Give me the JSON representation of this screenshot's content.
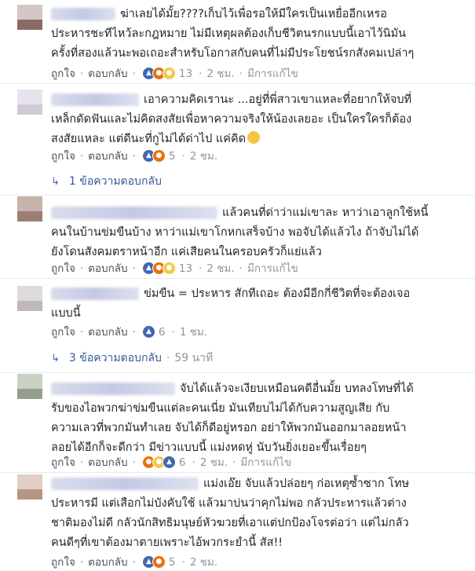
{
  "actions": {
    "like_label": "ถูกใจ",
    "reply_label": "ตอบกลับ",
    "edited_label": "มีการแก้ไข"
  },
  "comments": [
    {
      "text": "ฆ่าเลยได้มั้ย????เก็บไว้เพื่อรอให้มีใครเป็นเหยื่ออีกเหรอ\nประหารชะทีไหว้ละกฎหมาย ไม่มีเหตุผลต้องเก็บชีวิตนรกแบบนี้เอาไว้นิมัน\nครั้งที่สองแล้วนะพอเถอะสำหรับโอกาสกับคนที่ไม่มีประโยชน์รกสังคมเปล่าๆ",
      "reaction_count": "13",
      "time": "2 ชม.",
      "edited": true,
      "reactions": [
        "like",
        "angry",
        "sad"
      ]
    },
    {
      "text": "เอาความคิดเรานะ ...อยู่ที่พี่สาวเขาแหละที่อยากให้จบที่\nเหล็กดัดฟันและไม่คิดสงสัยเพื่อหาความจริงให้น้องเลยอะ เป็นใครใครก็ต้อง\nสงสัยแหละ แต่ดีนะที่กูไม่ได้ด่าไป แค่คิด",
      "emoji": "grin-emoji",
      "reaction_count": "5",
      "time": "2 ชม.",
      "edited": false,
      "reactions": [
        "like",
        "angry"
      ],
      "replies": "1 ข้อความตอบกลับ"
    },
    {
      "text": "แล้วคนที่ด่าว่าแม่เขาละ หาว่าเอาลูกใช้หนี้\nคนในบ้านข่มขืนบ้าง หาว่าแม่เขาโกหกเสร็จบ้าง พอจับได้แล้วไง ถ้าจับไม่ได้\nยังโดนสังคมตราหน้าอีก แค่เสียคนในครอบครัวก็แย่แล้ว",
      "reaction_count": "13",
      "time": "2 ชม.",
      "edited": true,
      "reactions": [
        "like",
        "angry",
        "sad"
      ]
    },
    {
      "text": "ข่มขืน = ประหาร สักทีเถอะ ต้องมีอีกกี่ชีวิตที่จะต้องเจอ\nแบบนี้",
      "reaction_count": "6",
      "time": "1 ชม.",
      "edited": false,
      "reactions": [
        "like"
      ],
      "replies": "3 ข้อความตอบกลับ",
      "replies_time": "59 นาที"
    },
    {
      "text": "จับได้แล้วจะเงียบเหมือนคดีอื่นมั้ย บทลงโทษที่ได้\nรับของไอพวกฆ่าข่มขืนแต่ละคนเนี่ย มันเทียบไม่ได้กับความสูญเสีย กับ\nความเลวที่พวกมันทำเลย จับได้ก็ดีอยู่หรอก อย่าให้พวกมันออกมาลอยหน้า\nลอยได้อีกก็จะดีกว่า มีข่าวแบบนี้ แม่งหดหู่ นับวันยิ่งเยอะขึ้นเรื่อยๆ",
      "reaction_count": "6",
      "time": "2 ชม.",
      "edited": true,
      "reactions": [
        "angry",
        "sad",
        "like"
      ]
    },
    {
      "text": "แม่งเอ๊ย จับแล้วปล่อยๆ ก่อเหตุซ้ำซาก โทษ\nประหารมี แต่เสือกไม่บังคับใช้ แล้วมาบ่นว่าคุกไม่พอ กลัวประหารแล้วต่าง\nชาติมองไม่ดี กลัวนักสิทธิมนุษย์หัวฆวยที่เอาแต่ปกป้องโจรต่อว่า แต่ไม่กลัว\nคนดีๆที่เขาต้องมาตายเพราะไอ้พวกระยำนี้ สัส!!",
      "reaction_count": "5",
      "time": "2 ชม.",
      "edited": false,
      "reactions": [
        "like",
        "angry"
      ]
    }
  ]
}
